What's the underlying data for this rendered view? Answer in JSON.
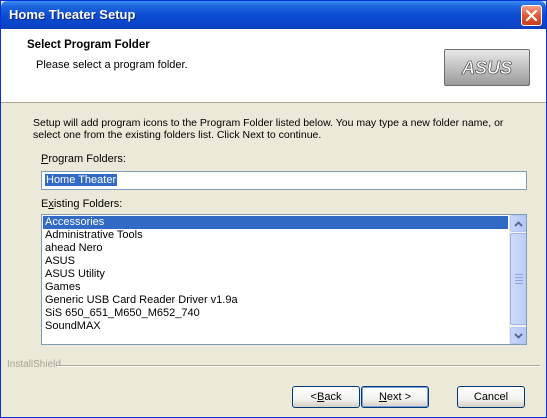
{
  "window": {
    "title": "Home Theater Setup"
  },
  "header": {
    "title": "Select Program Folder",
    "subtitle": "Please select a program folder.",
    "logo_text": "ASUS"
  },
  "description": "Setup will add program icons to the Program Folder listed below.  You may type a new folder name, or select one from the existing folders list.  Click Next to continue.",
  "program_folders": {
    "label_underlined": "P",
    "label_rest": "rogram Folders:",
    "value": "Home Theater"
  },
  "existing_folders": {
    "label_first": "E",
    "label_underlined": "x",
    "label_rest": "isting Folders:",
    "items": [
      "Accessories",
      "Administrative Tools",
      "ahead Nero",
      "ASUS",
      "ASUS Utility",
      "Games",
      "Generic USB Card Reader Driver v1.9a",
      "SiS 650_651_M650_M652_740",
      "SoundMAX"
    ],
    "selected_index": 0
  },
  "footer": {
    "brand": "InstallShield"
  },
  "buttons": {
    "back_prefix": "< ",
    "back_underlined": "B",
    "back_rest": "ack",
    "next_underlined": "N",
    "next_rest": "ext >",
    "cancel": "Cancel"
  }
}
